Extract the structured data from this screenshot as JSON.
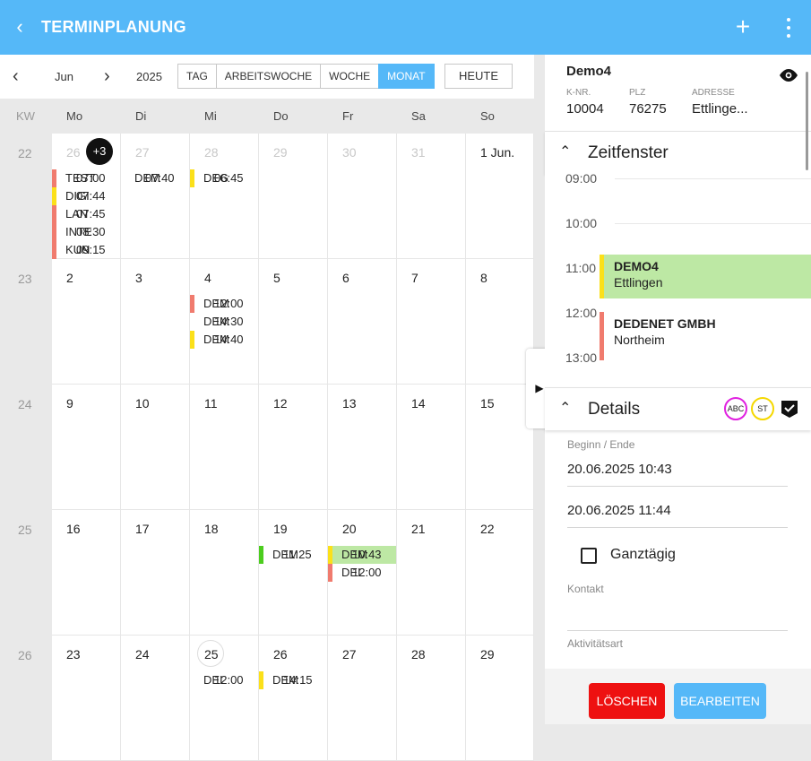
{
  "header": {
    "title": "TERMINPLANUNG"
  },
  "toolbar": {
    "month": "Jun",
    "year": "2025",
    "views": [
      "TAG",
      "ARBEITSWOCHE",
      "WOCHE",
      "MONAT"
    ],
    "active_view": "MONAT",
    "today_label": "HEUTE"
  },
  "columns": {
    "kw": "KW",
    "days": [
      "Mo",
      "Di",
      "Mi",
      "Do",
      "Fr",
      "Sa",
      "So"
    ]
  },
  "weeks": [
    {
      "kw": "22",
      "days": [
        "26",
        "27",
        "28",
        "29",
        "30",
        "31",
        "1 Jun."
      ],
      "more": "+3"
    },
    {
      "kw": "23",
      "days": [
        "2",
        "3",
        "4",
        "5",
        "6",
        "7",
        "8"
      ]
    },
    {
      "kw": "24",
      "days": [
        "9",
        "10",
        "11",
        "12",
        "13",
        "14",
        "15"
      ]
    },
    {
      "kw": "25",
      "days": [
        "16",
        "17",
        "18",
        "19",
        "20",
        "21",
        "22"
      ]
    },
    {
      "kw": "26",
      "days": [
        "23",
        "24",
        "25",
        "26",
        "27",
        "28",
        "29"
      ]
    }
  ],
  "events": [
    {
      "name": "TEST",
      "time": "07:00"
    },
    {
      "name": "DIGI",
      "time": "07:44"
    },
    {
      "name": "LAN",
      "time": "07:45"
    },
    {
      "name": "INTE",
      "time": "08:30"
    },
    {
      "name": "KUN",
      "time": "09:15"
    },
    {
      "name": "DEM",
      "time": "07:40"
    },
    {
      "name": "DEG",
      "time": "06:45"
    },
    {
      "name": "DEM",
      "time": "12:00"
    },
    {
      "name": "DEM",
      "time": "14:30"
    },
    {
      "name": "DEM",
      "time": "14:40"
    },
    {
      "name": "DEM",
      "time": "11:25"
    },
    {
      "name": "DEM",
      "time": "10:43"
    },
    {
      "name": "DEI",
      "time": "12:00"
    },
    {
      "name": "DEI",
      "time": "12:00"
    },
    {
      "name": "DEM",
      "time": "14:15"
    }
  ],
  "event_colors": {
    "red": "#f07b6e",
    "yellow": "#fbe01a",
    "green": "#4ccd1e",
    "highlight": "#bde8a4"
  },
  "panel": {
    "title": "Demo4",
    "knr_label": "K-NR.",
    "knr": "10004",
    "plz_label": "PLZ",
    "plz": "76275",
    "adresse_label": "ADRESSE",
    "adresse": "Ettlinge...",
    "zeitfenster": "Zeitfenster",
    "times": [
      "09:00",
      "10:00",
      "11:00",
      "12:00",
      "13:00"
    ],
    "tl_events": [
      {
        "name": "DEMO4",
        "place": "Ettlingen"
      },
      {
        "name": "DEDENET GMBH",
        "place": "Northeim"
      }
    ],
    "details": "Details",
    "chips": [
      "ABC",
      "ST"
    ],
    "beginn_label": "Beginn / Ende",
    "beginn": "20.06.2025 10:43",
    "ende": "20.06.2025 11:44",
    "ganztaegig": "Ganztägig",
    "kontakt_label": "Kontakt",
    "aktivitaet_label": "Aktivitätsart",
    "delete": "LÖSCHEN",
    "edit": "BEARBEITEN"
  }
}
